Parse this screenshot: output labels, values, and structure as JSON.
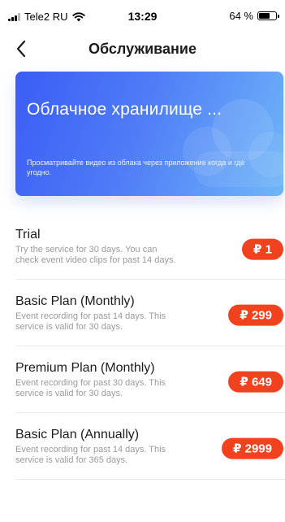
{
  "status_bar": {
    "carrier": "Tele2 RU",
    "time": "13:29",
    "battery": "64 %",
    "battery_level": 0.64,
    "icons": [
      "signal-icon",
      "wifi-icon",
      "battery-icon"
    ]
  },
  "nav": {
    "title": "Обслуживание",
    "back_icon": "chevron-left-icon"
  },
  "banner": {
    "title": "Облачное хранилище ...",
    "description": "Просматривайте видео из облака через приложение когда и где угодно.",
    "decoration_icon": "cloud-icon"
  },
  "plans": [
    {
      "name": "Trial",
      "description": "Try the service for 30 days. You can check event video clips for past 14 days.",
      "price": "₽ 1"
    },
    {
      "name": "Basic Plan (Monthly)",
      "description": "Event recording for past 14 days. This service is valid for 30 days.",
      "price": "₽ 299"
    },
    {
      "name": "Premium Plan (Monthly)",
      "description": "Event recording for past 30 days. This service is valid for 30 days.",
      "price": "₽ 649"
    },
    {
      "name": "Basic Plan (Annually)",
      "description": "Event recording for past 14 days. This service is valid for 365 days.",
      "price": "₽ 2999"
    }
  ],
  "colors": {
    "accent": "#f0421f",
    "banner_start": "#3b5df5",
    "banner_end": "#6fb6f8"
  }
}
